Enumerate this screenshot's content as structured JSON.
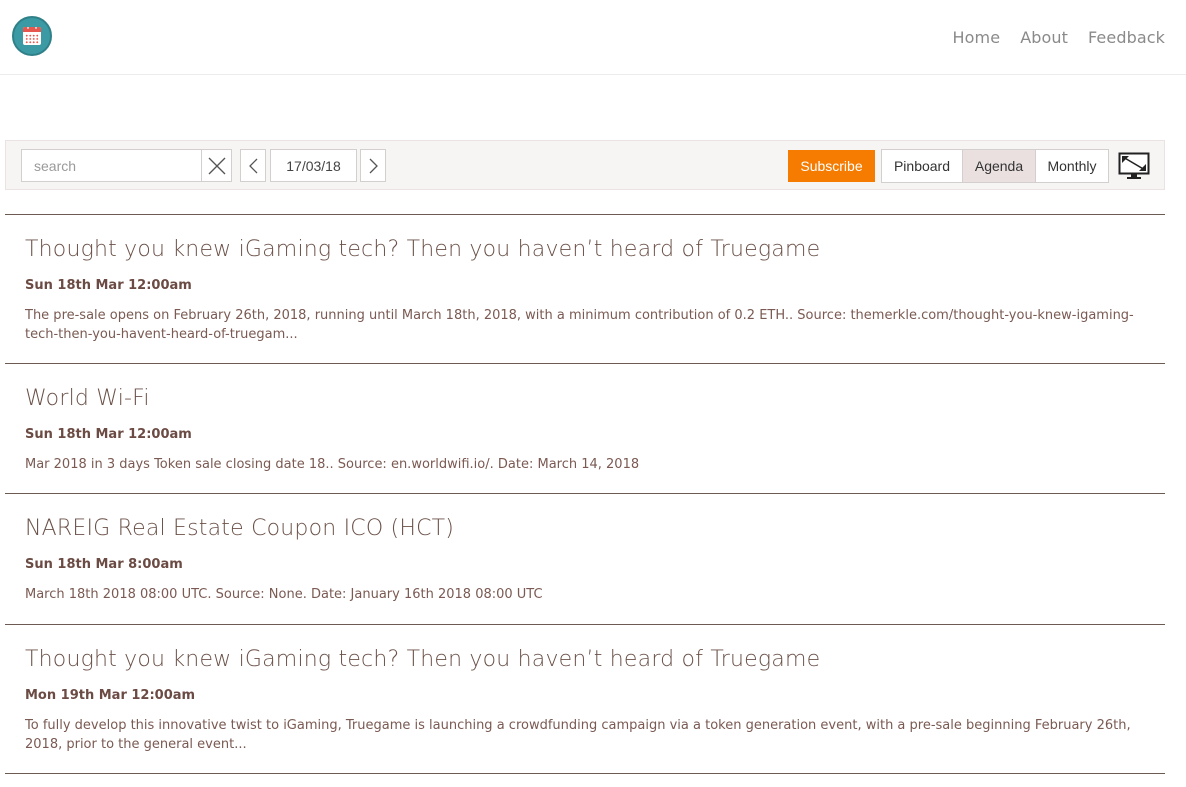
{
  "header": {
    "logo_icon": "calendar-icon",
    "nav": [
      {
        "label": "Home"
      },
      {
        "label": "About"
      },
      {
        "label": "Feedback"
      }
    ]
  },
  "toolbar": {
    "search_placeholder": "search",
    "search_value": "",
    "clear_icon": "close-icon",
    "prev_icon": "chevron-left-icon",
    "next_icon": "chevron-right-icon",
    "date": "17/03/18",
    "subscribe_label": "Subscribe",
    "views": [
      "Pinboard",
      "Agenda",
      "Monthly"
    ],
    "active_view": "Agenda",
    "fullscreen_icon": "fullscreen-icon"
  },
  "colors": {
    "accent": "#f57c00",
    "title": "#6b5148",
    "divider": "#6d5a52",
    "logo": "#3b9aa3"
  },
  "events": [
    {
      "title": "Thought you knew iGaming tech? Then you haven’t heard of Truegame",
      "date": "Sun 18th Mar 12:00am",
      "description": "The pre-sale opens on February 26th, 2018, running until March 18th, 2018, with a minimum contribution of 0.2 ETH.. Source: themerkle.com/thought-you-knew-igaming-tech-then-you-havent-heard-of-truegam..."
    },
    {
      "title": "World Wi-Fi",
      "date": "Sun 18th Mar 12:00am",
      "description": "Mar 2018 in 3 days Token sale closing date 18.. Source: en.worldwifi.io/. Date: March 14, 2018"
    },
    {
      "title": "NAREIG Real Estate Coupon ICO (HCT)",
      "date": "Sun 18th Mar 8:00am",
      "description": "March 18th 2018 08:00 UTC. Source: None. Date: January 16th 2018 08:00 UTC"
    },
    {
      "title": "Thought you knew iGaming tech? Then you haven’t heard of Truegame",
      "date": "Mon 19th Mar 12:00am",
      "description": "To fully develop this innovative twist to iGaming, Truegame is launching a crowdfunding campaign via a token generation event, with a pre-sale beginning February 26th, 2018, prior to the general event..."
    }
  ]
}
